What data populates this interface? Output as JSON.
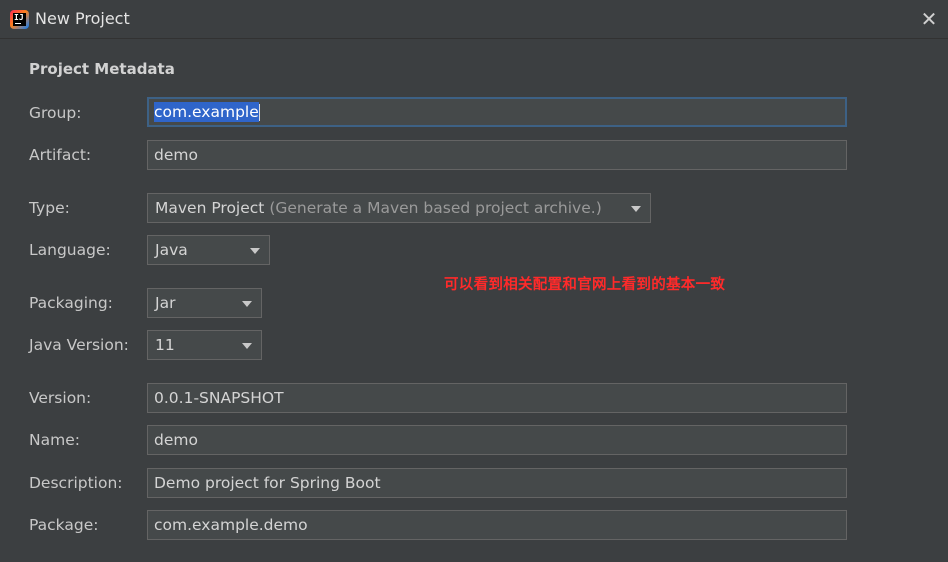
{
  "window": {
    "title": "New Project",
    "icon": "intellij-idea-icon",
    "icon_text": "IJ",
    "close_icon": "close-icon"
  },
  "metadata": {
    "section_title": "Project Metadata",
    "group": {
      "label": "Group:",
      "value": "com.example"
    },
    "artifact": {
      "label": "Artifact:",
      "value": "demo"
    },
    "type": {
      "label": "Type:",
      "value": "Maven Project",
      "hint": "(Generate a Maven based project archive.)"
    },
    "language": {
      "label": "Language:",
      "value": "Java"
    },
    "packaging": {
      "label": "Packaging:",
      "value": "Jar"
    },
    "java_version": {
      "label": "Java Version:",
      "value": "11"
    },
    "version": {
      "label": "Version:",
      "value": "0.0.1-SNAPSHOT"
    },
    "name": {
      "label": "Name:",
      "value": "demo"
    },
    "description": {
      "label": "Description:",
      "value": "Demo project for Spring Boot"
    },
    "package": {
      "label": "Package:",
      "value": "com.example.demo"
    }
  },
  "annotation": {
    "text": "可以看到相关配置和官网上看到的基本一致",
    "color": "#ff2a2a"
  },
  "colors": {
    "background": "#3c3f41",
    "field_background": "#45494a",
    "focus_border": "#3d6185",
    "selection": "#2f65ca"
  }
}
